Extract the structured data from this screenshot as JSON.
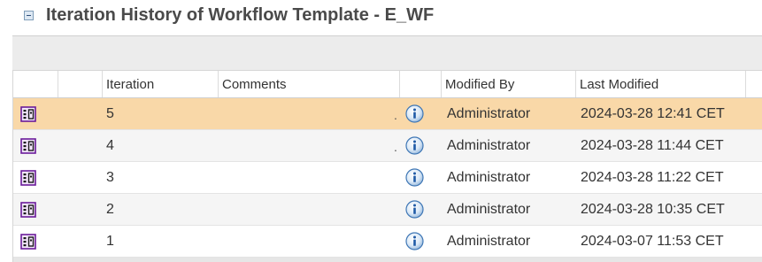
{
  "panel": {
    "title": "Iteration History of Workflow Template - E_WF"
  },
  "table": {
    "headers": {
      "iteration": "Iteration",
      "comments": "Comments",
      "modified_by": "Modified By",
      "last_modified": "Last Modified"
    },
    "rows": [
      {
        "iteration": "5",
        "comments": "",
        "marker": ".",
        "modified_by": "Administrator",
        "last_modified": "2024-03-28 12:41 CET",
        "selected": true
      },
      {
        "iteration": "4",
        "comments": "",
        "marker": ".",
        "modified_by": "Administrator",
        "last_modified": "2024-03-28 11:44 CET",
        "selected": false
      },
      {
        "iteration": "3",
        "comments": "",
        "marker": "",
        "modified_by": "Administrator",
        "last_modified": "2024-03-28 11:22 CET",
        "selected": false
      },
      {
        "iteration": "2",
        "comments": "",
        "marker": "",
        "modified_by": "Administrator",
        "last_modified": "2024-03-28 10:35 CET",
        "selected": false
      },
      {
        "iteration": "1",
        "comments": "",
        "marker": "",
        "modified_by": "Administrator",
        "last_modified": "2024-03-07 11:53 CET",
        "selected": false
      }
    ]
  },
  "icons": {
    "collapse": "collapse-icon",
    "row_type": "workflow-template-icon",
    "info": "info-icon"
  },
  "colors": {
    "selected_row": "#f9d8a8",
    "alt_row": "#f5f5f5",
    "title_text": "#4a4a4a"
  }
}
